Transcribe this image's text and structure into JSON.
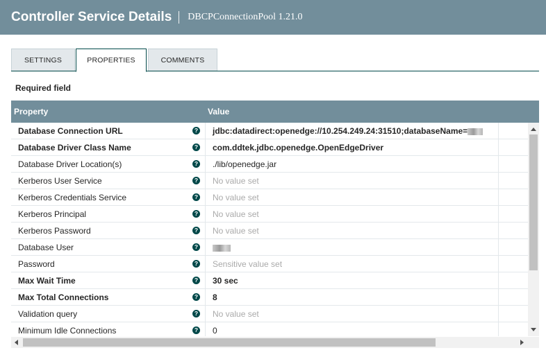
{
  "header": {
    "title": "Controller Service Details",
    "subtitle": "DBCPConnectionPool 1.21.0"
  },
  "tabs": [
    {
      "label": "SETTINGS",
      "active": false
    },
    {
      "label": "PROPERTIES",
      "active": true
    },
    {
      "label": "COMMENTS",
      "active": false
    }
  ],
  "required_label": "Required field",
  "table": {
    "columns": {
      "property": "Property",
      "value": "Value"
    },
    "help_icon": "question-circle-icon",
    "rows": [
      {
        "property": "Database Connection URL",
        "value": "jdbc:datadirect:openedge://10.254.249.24:31510;databaseName=",
        "required": true,
        "set": true,
        "redacted": true
      },
      {
        "property": "Database Driver Class Name",
        "value": "com.ddtek.jdbc.openedge.OpenEdgeDriver",
        "required": true,
        "set": true
      },
      {
        "property": "Database Driver Location(s)",
        "value": "./lib/openedge.jar",
        "required": false,
        "set": true
      },
      {
        "property": "Kerberos User Service",
        "value": "No value set",
        "required": false,
        "set": false
      },
      {
        "property": "Kerberos Credentials Service",
        "value": "No value set",
        "required": false,
        "set": false
      },
      {
        "property": "Kerberos Principal",
        "value": "No value set",
        "required": false,
        "set": false
      },
      {
        "property": "Kerberos Password",
        "value": "No value set",
        "required": false,
        "set": false
      },
      {
        "property": "Database User",
        "value": "",
        "required": false,
        "set": true,
        "redacted": true
      },
      {
        "property": "Password",
        "value": "Sensitive value set",
        "required": false,
        "set": false
      },
      {
        "property": "Max Wait Time",
        "value": "30 sec",
        "required": true,
        "set": true
      },
      {
        "property": "Max Total Connections",
        "value": "8",
        "required": true,
        "set": true
      },
      {
        "property": "Validation query",
        "value": "No value set",
        "required": false,
        "set": false
      },
      {
        "property": "Minimum Idle Connections",
        "value": "0",
        "required": false,
        "set": true
      }
    ]
  },
  "colors": {
    "header_bg": "#728e9b",
    "accent": "#004849",
    "tab_bg": "#e3e8eb",
    "unset_text": "#aaaaaa"
  }
}
